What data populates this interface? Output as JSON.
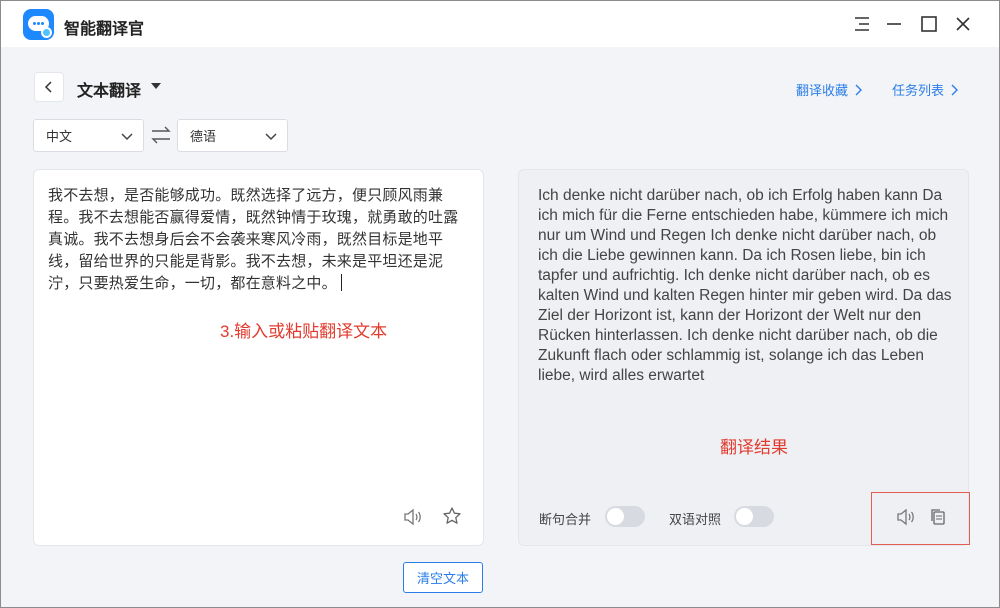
{
  "app": {
    "title": "智能翻译官",
    "accent": "#2b7de9",
    "annotation_color": "#e23b2e"
  },
  "window_controls": [
    {
      "name": "menu-icon"
    },
    {
      "name": "minimize-icon"
    },
    {
      "name": "maximize-icon"
    },
    {
      "name": "close-icon"
    }
  ],
  "header": {
    "page_title": "文本翻译",
    "links": {
      "favorites": "翻译收藏",
      "tasks": "任务列表"
    }
  },
  "languages": {
    "source": "中文",
    "target": "德语"
  },
  "source_panel": {
    "text": "我不去想，是否能够成功。既然选择了远方，便只顾风雨兼程。我不去想能否赢得爱情，既然钟情于玫瑰，就勇敢的吐露真诚。我不去想身后会不会袭来寒风冷雨，既然目标是地平线，留给世界的只能是背影。我不去想，未来是平坦还是泥泞，只要热爱生命，一切，都在意料之中。",
    "annotation": "3.输入或粘贴翻译文本"
  },
  "target_panel": {
    "text": "Ich denke nicht darüber nach, ob ich Erfolg haben kann Da ich mich für die Ferne entschieden habe, kümmere ich mich nur um Wind und Regen Ich denke nicht darüber nach, ob ich die Liebe gewinnen kann. Da ich Rosen liebe, bin ich tapfer und aufrichtig. Ich denke nicht darüber nach, ob es kalten Wind und kalten Regen hinter mir geben wird. Da das Ziel der Horizont ist, kann der Horizont der Welt nur den Rücken hinterlassen. Ich denke nicht darüber nach, ob die Zukunft flach oder schlammig ist, solange ich das Leben liebe, wird alles erwartet",
    "annotation": "翻译结果",
    "toggles": {
      "merge_sentences": "断句合并",
      "bilingual": "双语对照"
    }
  },
  "actions": {
    "clear": "清空文本"
  }
}
